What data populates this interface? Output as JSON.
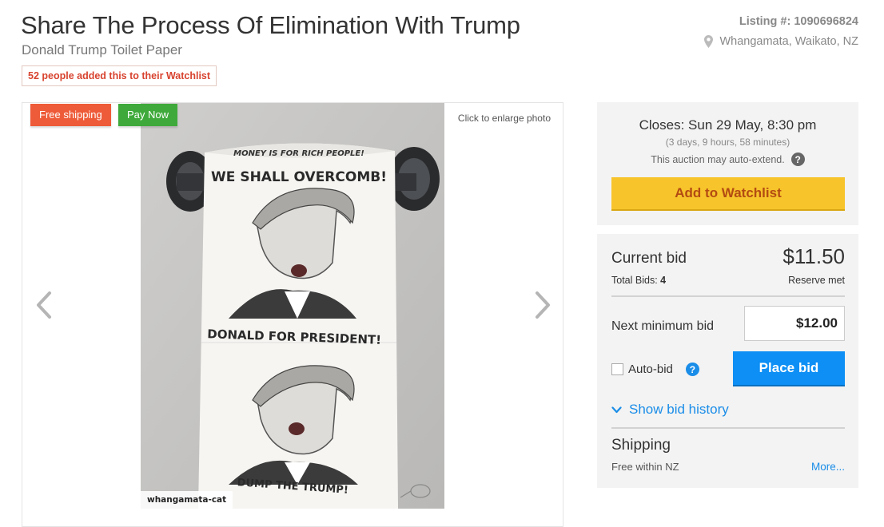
{
  "header": {
    "title": "Share The Process Of Elimination With Trump",
    "subtitle": "Donald Trump Toilet Paper",
    "watchlist_badge": "52 people added this to their Watchlist",
    "listing_number": "Listing #: 1090696824",
    "location": "Whangamata, Waikato, NZ",
    "location_icon": "map-pin-icon"
  },
  "photo": {
    "tags": {
      "free_shipping": "Free shipping",
      "pay_now": "Pay Now"
    },
    "enlarge_hint": "Click to enlarge photo",
    "roll_lines": {
      "top": "MONEY IS FOR RICH PEOPLE!",
      "slogan": "WE SHALL OVERCOMB!",
      "middle": "DONALD FOR PRESIDENT!",
      "bottom": "DUMP THE TRUMP!"
    },
    "watermark": "whangamata-cat",
    "prev_icon": "chevron-left-icon",
    "next_icon": "chevron-right-icon"
  },
  "auction": {
    "closes": "Closes: Sun 29 May, 8:30 pm",
    "countdown": "(3 days, 9 hours, 58 minutes)",
    "auto_extend": "This auction may auto-extend.",
    "help_icon": "?",
    "watchlist_button": "Add to Watchlist"
  },
  "bidding": {
    "current_bid_label": "Current bid",
    "current_bid": "$11.50",
    "total_bids_label": "Total Bids: ",
    "total_bids": "4",
    "reserve": "Reserve met",
    "next_min_label": "Next minimum bid",
    "next_min_value": "$12.00",
    "autobid_label": "Auto-bid",
    "autobid_help": "?",
    "place_bid": "Place bid",
    "show_history": "Show bid history",
    "shipping_label": "Shipping",
    "shipping_value": "Free within NZ",
    "more": "More..."
  },
  "colors": {
    "free_shipping": "#ee5b38",
    "pay_now": "#3faa3b",
    "watchlist_button": "#f7c42b",
    "place_bid": "#0d8ff5",
    "link": "#1a8de8",
    "badge_text": "#d8432f"
  }
}
